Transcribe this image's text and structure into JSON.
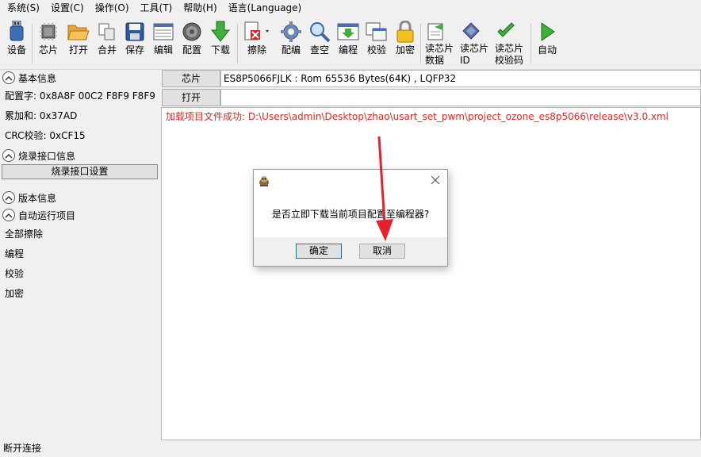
{
  "menu": [
    "系统(S)",
    "设置(C)",
    "操作(O)",
    "工具(T)",
    "帮助(H)",
    "语言(Language)"
  ],
  "toolbar": {
    "device": "设备",
    "chip": "芯片",
    "open": "打开",
    "merge": "合并",
    "save": "保存",
    "edit": "编辑",
    "config": "配置",
    "download": "下载",
    "erase": "擦除",
    "config_edit": "配编",
    "check_blank": "查空",
    "program": "编程",
    "verify": "校验",
    "encrypt": "加密",
    "read_data": [
      "读芯片",
      "数据"
    ],
    "read_id": [
      "读芯片",
      "ID"
    ],
    "read_checksum": [
      "读芯片",
      "校验码"
    ],
    "auto": "自动"
  },
  "left": {
    "basic_info": "基本信息",
    "config_word": "配置字: 0x8A8F 00C2 F8F9 F8F9 F",
    "checksum_sum": "累加和: 0x37AD",
    "crc": "CRC校验: 0xCF15",
    "burn_if_info": "烧录接口信息",
    "burn_if_settings": "烧录接口设置",
    "version_info": "版本信息",
    "auto_items": "自动运行项目",
    "items": [
      "全部擦除",
      "编程",
      "校验",
      "加密"
    ]
  },
  "right": {
    "chip_btn": "芯片",
    "chip_value": "ES8P5066FJLK : Rom 65536 Bytes(64K) , LQFP32",
    "open_btn": "打开",
    "open_value": "",
    "log_message": "加载项目文件成功: D:\\Users\\admin\\Desktop\\zhao\\usart_set_pwm\\project_ozone_es8p5066\\release\\v3.0.xml"
  },
  "dialog": {
    "message": "是否立即下载当前项目配置至编程器?",
    "ok": "确定",
    "cancel": "取消"
  },
  "status": "断开连接",
  "colors": {
    "log_text": "#e8261f",
    "arrow": "#e8202a"
  }
}
